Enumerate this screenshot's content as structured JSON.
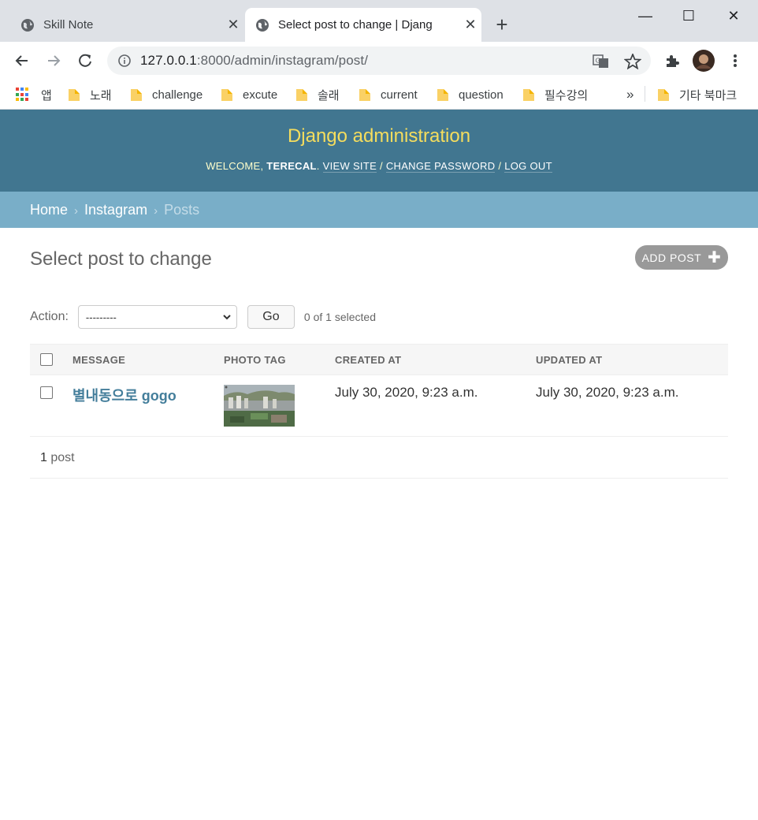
{
  "browser": {
    "tabs": [
      {
        "title": "Skill Note",
        "active": false
      },
      {
        "title": "Select post to change | Djang",
        "active": true
      }
    ],
    "url": {
      "host": "127.0.0.1",
      "rest": ":8000/admin/instagram/post/"
    },
    "bookmarks": [
      "앱",
      "노래",
      "challenge",
      "excute",
      "솔래",
      "current",
      "question",
      "필수강의"
    ],
    "more_bookmarks": "»",
    "other_bookmarks": "기타 북마크"
  },
  "admin": {
    "branding": "Django administration",
    "welcome": "WELCOME,",
    "username": "TERECAL",
    "view_site": "VIEW SITE",
    "change_password": "CHANGE PASSWORD",
    "log_out": "LOG OUT",
    "separator": "/",
    "breadcrumbs": {
      "home": "Home",
      "app": "Instagram",
      "current": "Posts",
      "sep": "›"
    },
    "title": "Select post to change",
    "add_button": "ADD POST",
    "action_label": "Action:",
    "action_selected": "---------",
    "go_button": "Go",
    "selection_counter": "0 of 1 selected",
    "columns": [
      "MESSAGE",
      "PHOTO TAG",
      "CREATED AT",
      "UPDATED AT"
    ],
    "rows": [
      {
        "message": "별내동으로 gogo",
        "created_at": "July 30, 2020, 9:23 a.m.",
        "updated_at": "July 30, 2020, 9:23 a.m."
      }
    ],
    "paginator": {
      "count": "1",
      "label": "post"
    }
  },
  "colors": {
    "header_bg": "#417690",
    "branding": "#f5dd5d",
    "breadcrumbs_bg": "#79aec8",
    "link": "#447e9b"
  }
}
